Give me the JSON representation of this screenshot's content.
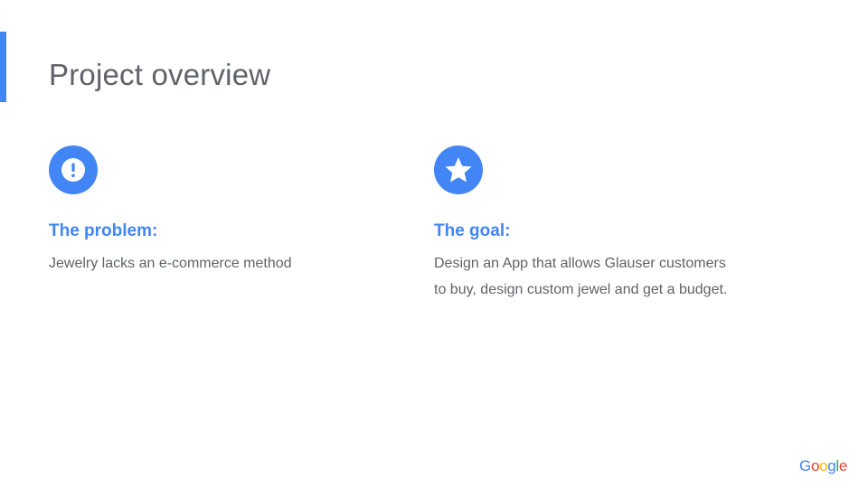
{
  "slide": {
    "title": "Project overview",
    "accent_color": "#4285f4"
  },
  "problem": {
    "icon": "exclamation-icon",
    "heading": "The problem:",
    "body_lines": [
      "Jewelry lacks an e-commerce method"
    ]
  },
  "goal": {
    "icon": "star-icon",
    "heading": "The goal:",
    "body_lines": [
      "Design an App that allows Glauser customers",
      "to buy, design custom jewel and get a budget."
    ]
  },
  "footer": {
    "logo_letters": [
      "G",
      "o",
      "o",
      "g",
      "l",
      "e"
    ],
    "logo_colors": [
      "#4285f4",
      "#ea4335",
      "#fbbc05",
      "#4285f4",
      "#34a853",
      "#ea4335"
    ]
  },
  "colors": {
    "text": "#5f6368",
    "heading": "#4285f4"
  }
}
